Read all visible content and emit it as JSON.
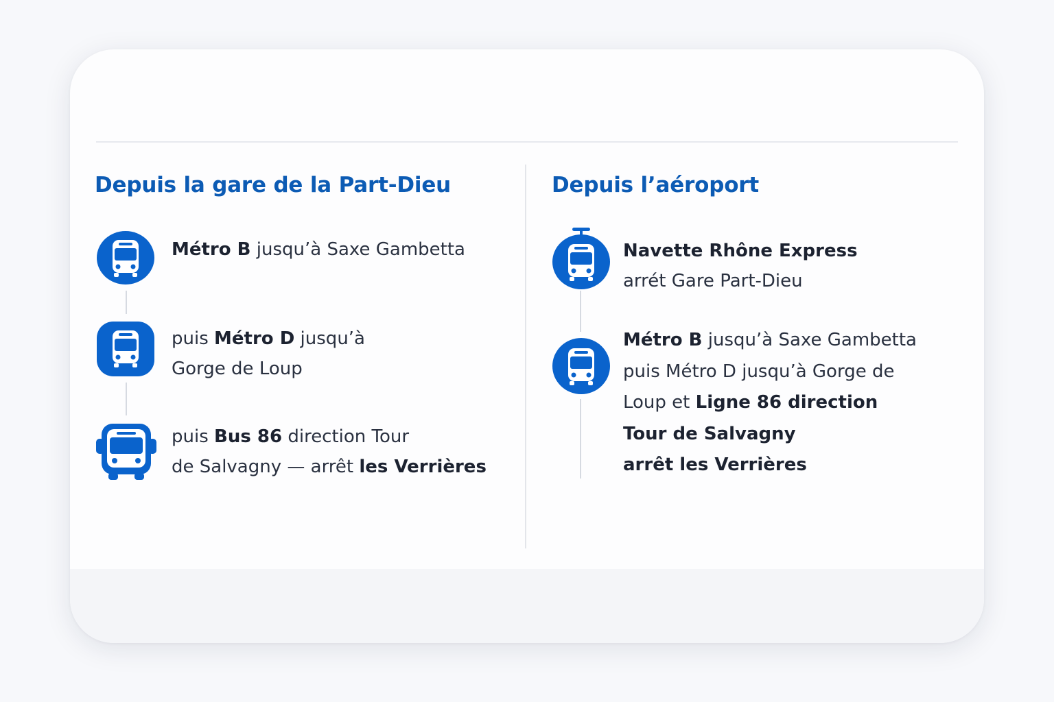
{
  "colors": {
    "accent": "#0c5bb4",
    "icon_fill": "#0a63cc",
    "text": "#2a3140",
    "divider": "#e3e5ea"
  },
  "left": {
    "title": "Depuis la gare de la Part-Dieu",
    "steps": [
      {
        "icon": "tram-icon",
        "lines": [
          [
            {
              "t": "Métro B",
              "b": true
            },
            {
              "t": " jusqu’à Saxe Gambetta",
              "b": false
            }
          ]
        ]
      },
      {
        "icon": "tram-icon",
        "lines": [
          [
            {
              "t": "puis ",
              "b": false
            },
            {
              "t": "Métro D",
              "b": true
            },
            {
              "t": " jusqu’à",
              "b": false
            }
          ],
          [
            {
              "t": "Gorge de Loup",
              "b": false
            }
          ]
        ]
      },
      {
        "icon": "bus-icon",
        "lines": [
          [
            {
              "t": "puis ",
              "b": false
            },
            {
              "t": "Bus 86",
              "b": true
            },
            {
              "t": " direction Tour",
              "b": false
            }
          ],
          [
            {
              "t": "de Salvagny — arrêt ",
              "b": false
            },
            {
              "t": "les Verrières",
              "b": true
            }
          ]
        ]
      }
    ]
  },
  "right": {
    "title": "Depuis l’aéroport",
    "steps": [
      {
        "icon": "tram-icon",
        "lines": [
          [
            {
              "t": "Navette Rhône Express",
              "b": true
            }
          ],
          [
            {
              "t": "arrét Gare Part-Dieu",
              "b": false
            }
          ]
        ]
      },
      {
        "icon": "tram-icon",
        "lines": [
          [
            {
              "t": "Métro B",
              "b": true
            },
            {
              "t": " jusqu’à Saxe Gambetta",
              "b": false
            }
          ],
          [
            {
              "t": "puis Métro D jusqu’à Gorge de",
              "b": false
            }
          ],
          [
            {
              "t": "Loup et ",
              "b": false
            },
            {
              "t": "Ligne 86 direction",
              "b": true
            }
          ],
          [
            {
              "t": "Tour de Salvagny",
              "b": true
            }
          ],
          [
            {
              "t": "arrêt les Verrières",
              "b": true
            }
          ]
        ]
      }
    ]
  }
}
